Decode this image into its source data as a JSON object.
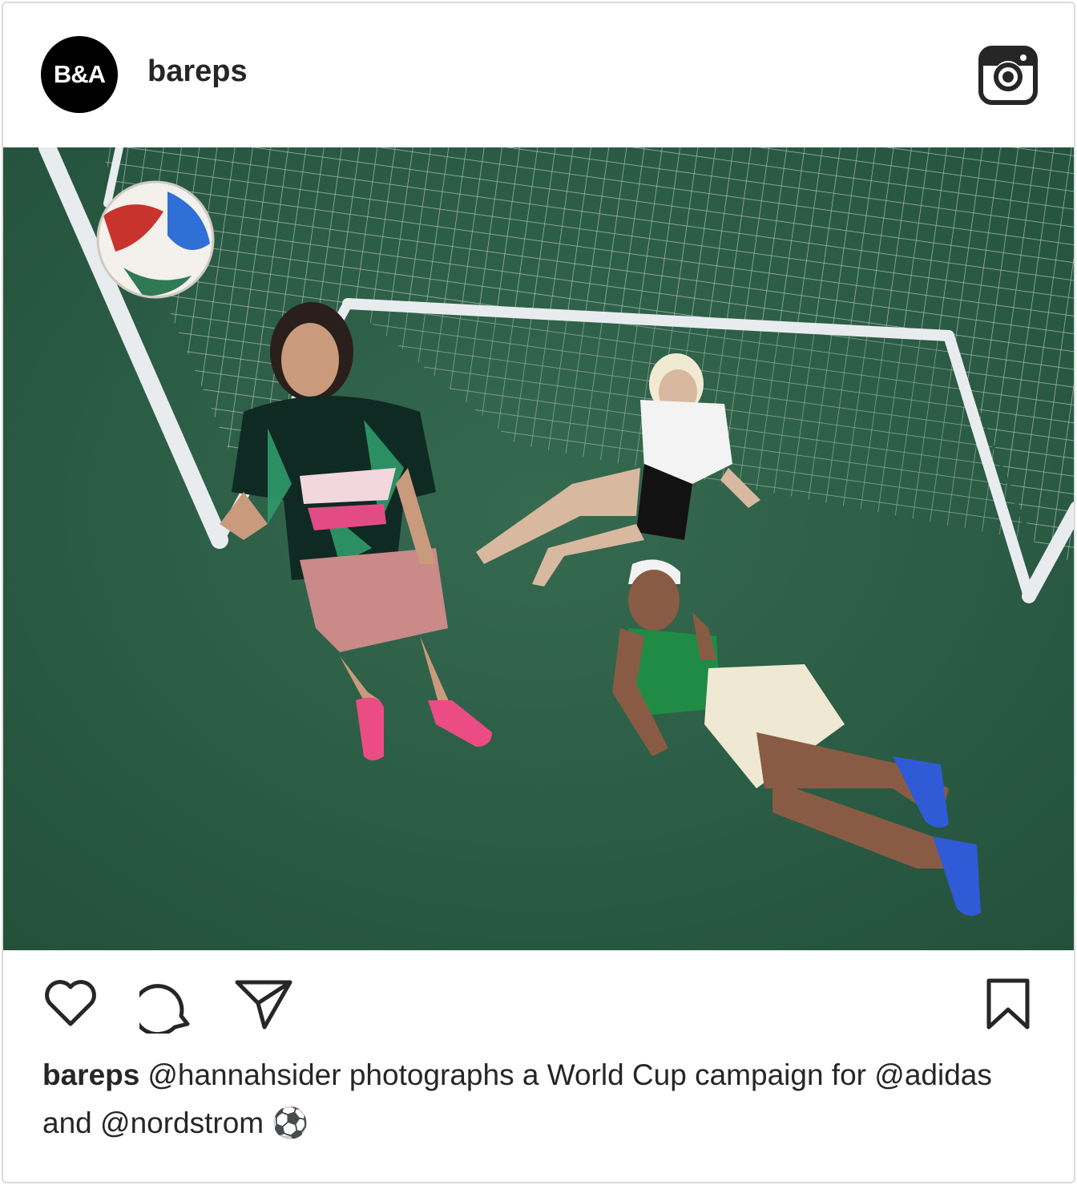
{
  "post": {
    "avatar_text": "B&A",
    "username": "bareps",
    "header_icon": "instagram-logo-icon",
    "photo_description_icon": "photo",
    "actions": {
      "like_icon": "heart-icon",
      "comment_icon": "comment-icon",
      "share_icon": "paper-plane-icon",
      "save_icon": "bookmark-icon"
    },
    "caption": {
      "username": "bareps",
      "text": "@hannahsider photographs a World Cup campaign for @adidas and @nordstrom ⚽"
    }
  },
  "colors": {
    "text": "#262626",
    "border": "#dbdbdb",
    "avatar_bg": "#000000",
    "turf": "#2c5a44"
  }
}
